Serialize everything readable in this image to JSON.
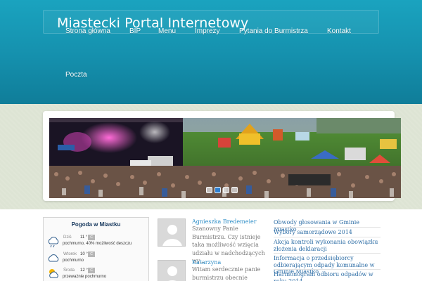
{
  "site": {
    "title": "Miastecki Portal Internetowy"
  },
  "nav": {
    "items": [
      {
        "label": "Strona główna"
      },
      {
        "label": "BIP"
      },
      {
        "label": "Menu"
      },
      {
        "label": "Imprezy"
      },
      {
        "label": "Pytania do Burmistrza"
      },
      {
        "label": "Kontakt"
      },
      {
        "label": "Poczta"
      }
    ]
  },
  "slider": {
    "slides": 4,
    "active_slide": 2
  },
  "weather": {
    "title": "Pogoda w Miastku",
    "days": [
      {
        "day": "Dziś",
        "temp": "11 °",
        "badge": "C",
        "desc": "pochmurno, 40% możliwość deszczu",
        "icon": "rain-cloud-icon"
      },
      {
        "day": "Wtorek",
        "temp": "10 °",
        "badge": "C",
        "desc": "pochmurno",
        "icon": "cloud-icon"
      },
      {
        "day": "Środa",
        "temp": "12 °",
        "badge": "C",
        "desc": "przeważnie pochmurno",
        "icon": "sun-cloud-icon"
      }
    ]
  },
  "comments": [
    {
      "author": "Agnieszka Bredemeier",
      "text": "Szanowny Panie Burmistrzu. Czy istnieje taka możliwość wzięcia udziału w nadchodzących wy..."
    },
    {
      "author": "Katarzyna",
      "text": "Witam serdecznie panie burmistrzu obecnie"
    }
  ],
  "news": [
    {
      "title": "Obwody głosowania w Gminie Miastko"
    },
    {
      "title": "Wybory samorządowe 2014"
    },
    {
      "title": "Akcja kontroli wykonania obowiązku złożenia deklaracji"
    },
    {
      "title": "Informacja o przedsiębiorcy odbierającym odpady komunalne w Gminie Miastko"
    },
    {
      "title": "Harmonogram odbioru odpadów w roku 2014"
    }
  ],
  "colors": {
    "header": "#1590ad",
    "link": "#2e6ea6",
    "comment_author": "#2e8ec7",
    "active_dot": "#2f7fd0"
  }
}
